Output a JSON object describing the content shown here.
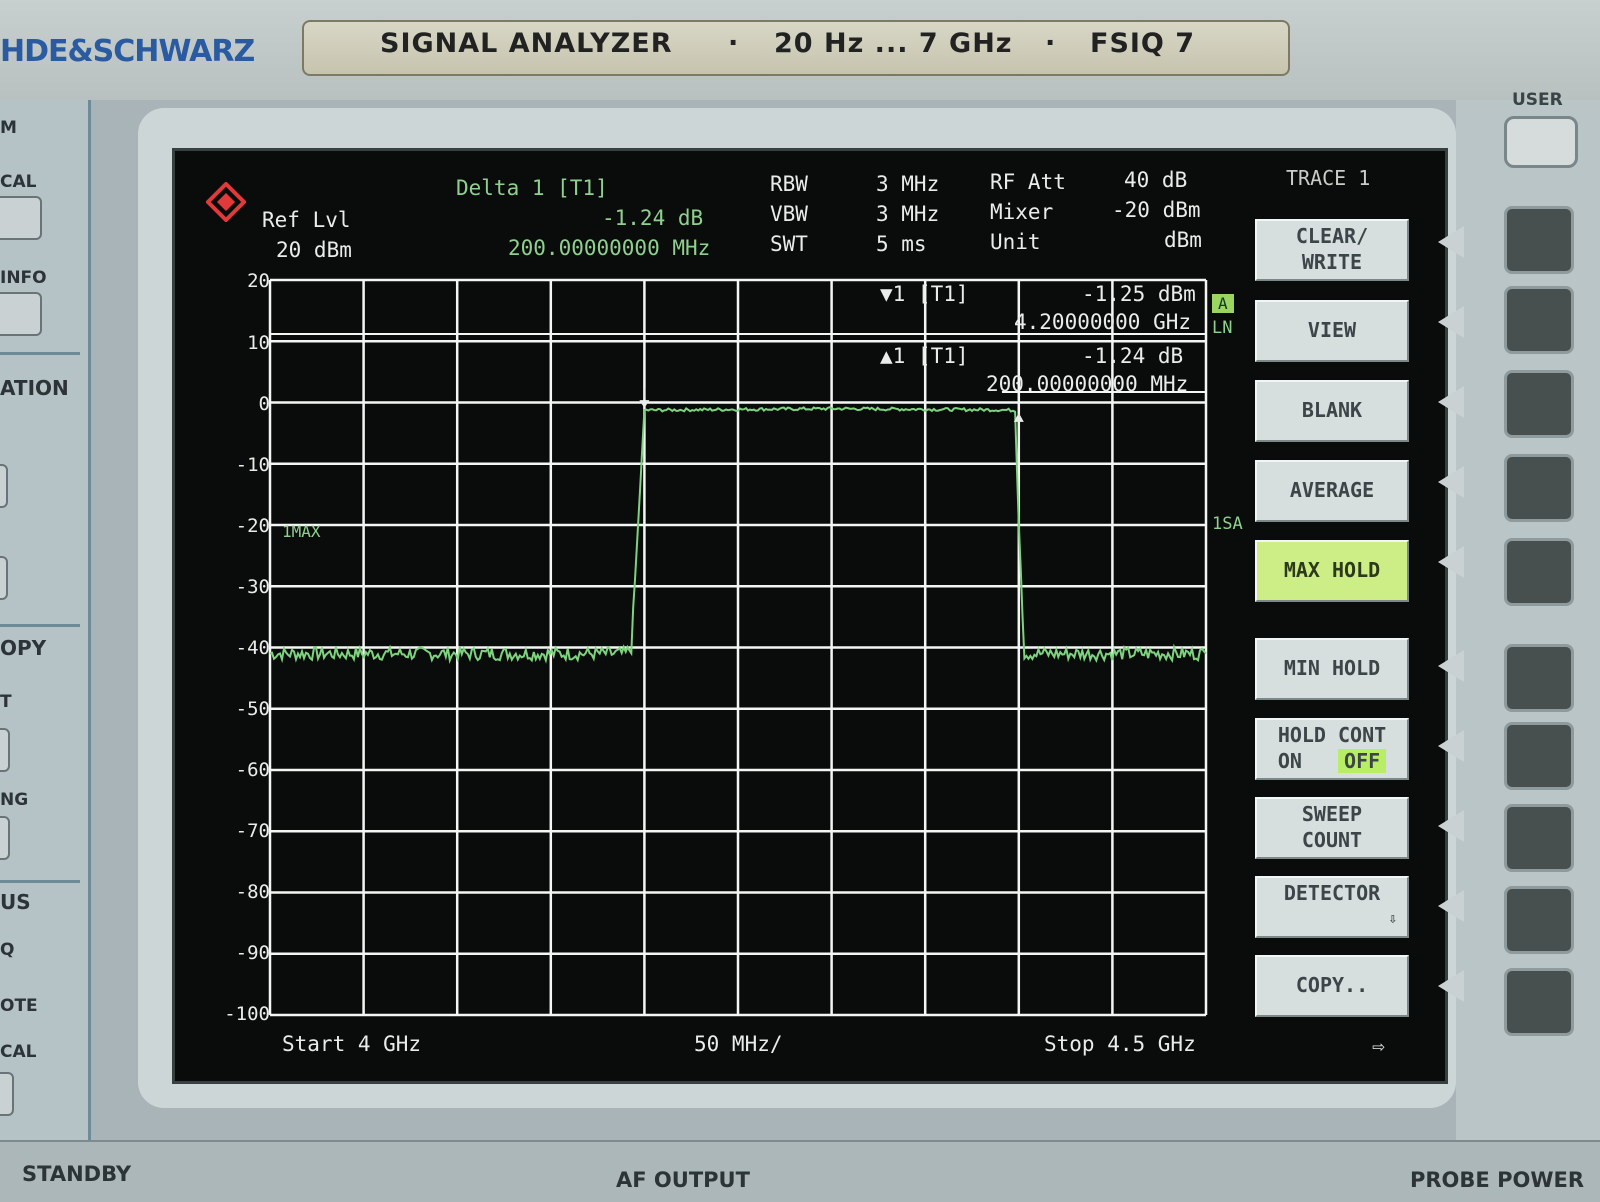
{
  "colors": {
    "trace": "#7ed37e",
    "grid": "#f4f6f4",
    "screen_bg": "#0a0c0b",
    "active_softkey": "#cdee86",
    "brand": "#2a5aa0"
  },
  "frame": {
    "brand": "HDE&SCHWARZ",
    "plate": {
      "name": "SIGNAL ANALYZER",
      "range": "20 Hz ... 7 GHz",
      "model": "FSIQ 7",
      "sep": "·"
    },
    "user_label": "USER",
    "left_labels": [
      "M",
      "CAL",
      "INFO",
      "ATION",
      "OPY",
      "T",
      "NG",
      "US",
      "Q",
      "OTE",
      "CAL"
    ],
    "bottom": {
      "standby": "STANDBY",
      "af_output": "AF OUTPUT",
      "probe_power": "PROBE POWER"
    }
  },
  "screen": {
    "ref_lvl_label": "Ref Lvl",
    "ref_lvl_value": "20 dBm",
    "delta": {
      "label": "Delta 1 [T1]",
      "value": "-1.24 dB",
      "freq": "200.00000000 MHz"
    },
    "params": {
      "rbw_label": "RBW",
      "rbw": "3 MHz",
      "vbw_label": "VBW",
      "vbw": "3 MHz",
      "swt_label": "SWT",
      "swt": "5 ms",
      "rfatt_label": "RF Att",
      "rfatt": "40 dB",
      "mixer_label": "Mixer",
      "mixer": "-20 dBm",
      "unit_label": "Unit",
      "unit": "dBm"
    },
    "marker1": {
      "label": "▼1 [T1]",
      "value": "-1.25 dBm",
      "freq": "4.20000000 GHz"
    },
    "delta1": {
      "label": "▲1 [T1]",
      "value": "-1.24 dB",
      "freq": "200.00000000 MHz"
    },
    "side_flags": {
      "a": "A",
      "lm": "LN",
      "sa": "1SA"
    },
    "trace_mode_label": "1MAX",
    "start": "Start 4 GHz",
    "span_div": "50 MHz/",
    "stop": "Stop 4.5 GHz",
    "arrow": "⇨",
    "trace_title": "TRACE 1",
    "softkeys": [
      {
        "l1": "CLEAR/",
        "l2": "WRITE"
      },
      {
        "l1": "VIEW",
        "l2": ""
      },
      {
        "l1": "BLANK",
        "l2": ""
      },
      {
        "l1": "AVERAGE",
        "l2": ""
      },
      {
        "l1": "MAX HOLD",
        "l2": ""
      },
      {
        "l1": "MIN HOLD",
        "l2": ""
      },
      {
        "l1": "HOLD CONT",
        "l2": ""
      },
      {
        "l1": "SWEEP",
        "l2": "COUNT"
      },
      {
        "l1": "DETECTOR",
        "l2": "⇩"
      },
      {
        "l1": "COPY..",
        "l2": ""
      }
    ],
    "hold_cont": {
      "on": "ON",
      "off": "OFF"
    }
  },
  "chart_data": {
    "type": "line",
    "xlabel": "",
    "ylabel": "",
    "x_range_ghz": [
      4.0,
      4.5
    ],
    "ylim": [
      -100,
      20
    ],
    "y_ticks": [
      "20",
      "10",
      "0",
      "-10",
      "-20",
      "-30",
      "-40",
      "-50",
      "-60",
      "-70",
      "-80",
      "-90",
      "-100"
    ],
    "grid": true,
    "series": [
      {
        "x_ghz": [
          4.0,
          4.19,
          4.193,
          4.2,
          4.3,
          4.39,
          4.398,
          4.4,
          4.403,
          4.5
        ],
        "values_dbm": [
          -41,
          -41,
          -40,
          -1.25,
          -1.0,
          -1.2,
          -1.3,
          -20,
          -41,
          -41
        ]
      }
    ],
    "markers": [
      {
        "x_ghz": 4.2,
        "y_dbm": -1.25
      },
      {
        "x_ghz": 4.4,
        "y_dbm": -2.5
      }
    ]
  }
}
